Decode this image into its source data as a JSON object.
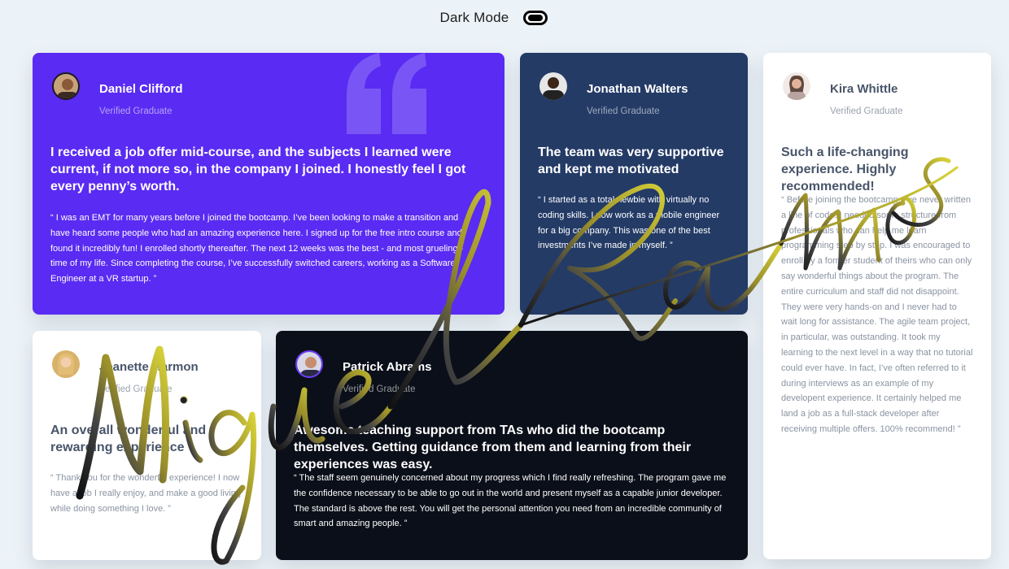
{
  "header": {
    "label": "Dark Mode",
    "toggle_icon": "toggle-switch-icon"
  },
  "colors": {
    "background": "#ecf3f8",
    "purple": "#5a2bf2",
    "navy": "#243b66",
    "white": "#ffffff",
    "black": "#0b0f19",
    "text_dark": "#48556a"
  },
  "testimonials": [
    {
      "name": "Daniel Clifford",
      "role": "Verified Graduate",
      "headline": "I received a job offer mid-course, and the subjects I learned were current, if not more so, in the company I joined. I honestly feel I got every penny’s worth.",
      "quote": "“ I was an EMT for many years before I joined the bootcamp. I’ve been looking to make a transition and have heard some people who had an amazing experience here. I signed up for the free intro course and found it incredibly fun! I enrolled shortly thereafter. The next 12 weeks was the best - and most grueling - time of my life. Since completing the course, I’ve successfully switched careers, working as a Software Engineer at a VR startup. ”"
    },
    {
      "name": "Jonathan Walters",
      "role": "Verified Graduate",
      "headline": "The team was very supportive and kept me motivated",
      "quote": "“ I started as a total newbie with virtually no coding skills. I now work as a mobile engineer for a big company. This was one of the best investments I’ve made in myself. ”"
    },
    {
      "name": "Kira Whittle",
      "role": "Verified Graduate",
      "headline": "Such a life-changing experience. Highly recommended!",
      "quote": "“ Before joining the bootcamp, I’ve never written a line of code. I needed some structure from professionals who can help me learn programming step by step. I was encouraged to enroll by a former student of theirs who can only say wonderful things about the program. The entire curriculum and staff did not disappoint. They were very hands-on and I never had to wait long for assistance. The agile team project, in particular, was outstanding. It took my learning to the next level in a way that no tutorial could ever have. In fact, I’ve often referred to it during interviews as an example of my developent experience. It certainly helped me land a job as a full-stack developer after receiving multiple offers. 100% recommend! ”"
    },
    {
      "name": "Jeanette Harmon",
      "role": "Verified Graduate",
      "headline": "An overall wonderful and rewarding experience",
      "quote": "“ Thank you for the wonderful experience! I now have a job I really enjoy, and make a good living while doing something I love. ”"
    },
    {
      "name": "Patrick Abrams",
      "role": "Verified Graduate",
      "headline": "Awesome teaching support from TAs who did the bootcamp themselves. Getting guidance from them and learning from their experiences was easy.",
      "quote": "“ The staff seem genuinely concerned about my progress which I find really refreshing. The program gave me the confidence necessary to be able to go out in the world and present myself as a capable junior developer. The standard is above the rest. You will get the personal attention you need from an incredible community of smart and amazing people. ”"
    }
  ],
  "signature_text": "Miguel Ramos"
}
